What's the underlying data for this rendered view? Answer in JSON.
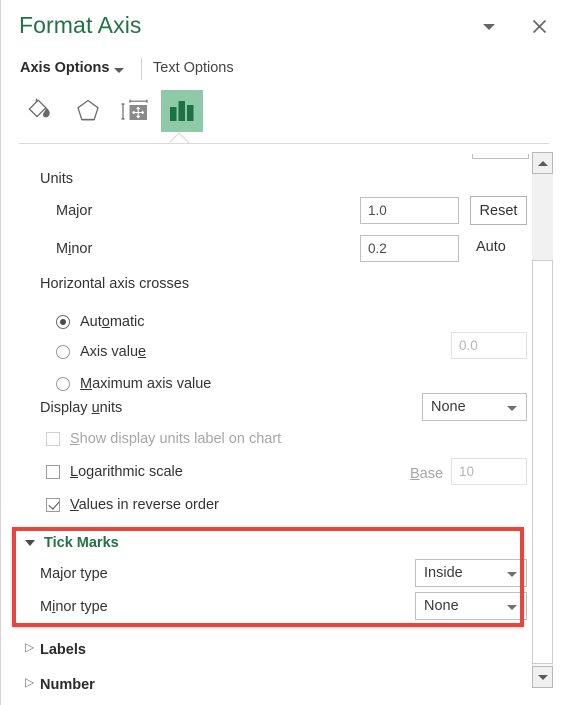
{
  "header": {
    "title": "Format Axis",
    "caret_icon": "chevron-down-icon",
    "close_icon": "close-icon"
  },
  "options_row": {
    "active_tab": "Axis Options",
    "inactive_tab": "Text Options"
  },
  "icon_tabs": [
    {
      "name": "fill-line-tab",
      "icon": "paint-bucket-icon",
      "active": false
    },
    {
      "name": "effects-tab",
      "icon": "pentagon-icon",
      "active": false
    },
    {
      "name": "size-properties-tab",
      "icon": "size-properties-icon",
      "active": false
    },
    {
      "name": "axis-options-tab",
      "icon": "bar-chart-icon",
      "active": true
    }
  ],
  "units": {
    "group_label": "Units",
    "major_label": "Major",
    "major_accel": "j",
    "major_value": "1.0",
    "reset_label": "Reset",
    "minor_label": "Minor",
    "minor_accel": "i",
    "minor_value": "0.2",
    "auto_label": "Auto"
  },
  "horizontal_axis_crosses": {
    "group_label": "Horizontal axis crosses",
    "options": [
      {
        "label": "Automatic",
        "accel": "o",
        "selected": true
      },
      {
        "label": "Axis value",
        "accel": "e",
        "selected": false
      },
      {
        "label": "Maximum axis value",
        "accel": "M",
        "selected": false
      }
    ],
    "axis_value_field": "0.0"
  },
  "display_units": {
    "label": "Display units",
    "accel": "u",
    "value": "None",
    "show_label_checkbox": "Show display units label on chart",
    "show_label_accel": "S",
    "show_label_checked": false,
    "show_label_disabled": true
  },
  "log_scale": {
    "label": "Logarithmic scale",
    "accel": "L",
    "checked": false,
    "base_label": "Base",
    "base_accel": "B",
    "base_value": "10",
    "base_disabled": true
  },
  "reverse_order": {
    "label": "Values in reverse order",
    "accel": "V",
    "checked": true
  },
  "tick_marks": {
    "section_title": "Tick Marks",
    "expanded": true,
    "major_type_label": "Major type",
    "major_type_accel": "j",
    "major_type_value": "Inside",
    "minor_type_label": "Minor type",
    "minor_type_accel": "i",
    "minor_type_value": "None"
  },
  "collapsed_sections": [
    {
      "title": "Labels"
    },
    {
      "title": "Number"
    }
  ],
  "annotation": {
    "target": "Tick Marks",
    "color": "#e8453c"
  },
  "scrollbar": {
    "up_icon": "scroll-up-arrow-icon",
    "down_icon": "scroll-down-arrow-icon"
  },
  "colors": {
    "accent_green": "#217346",
    "tab_highlight": "#8ec9a8",
    "annotation_red": "#e8453c"
  }
}
